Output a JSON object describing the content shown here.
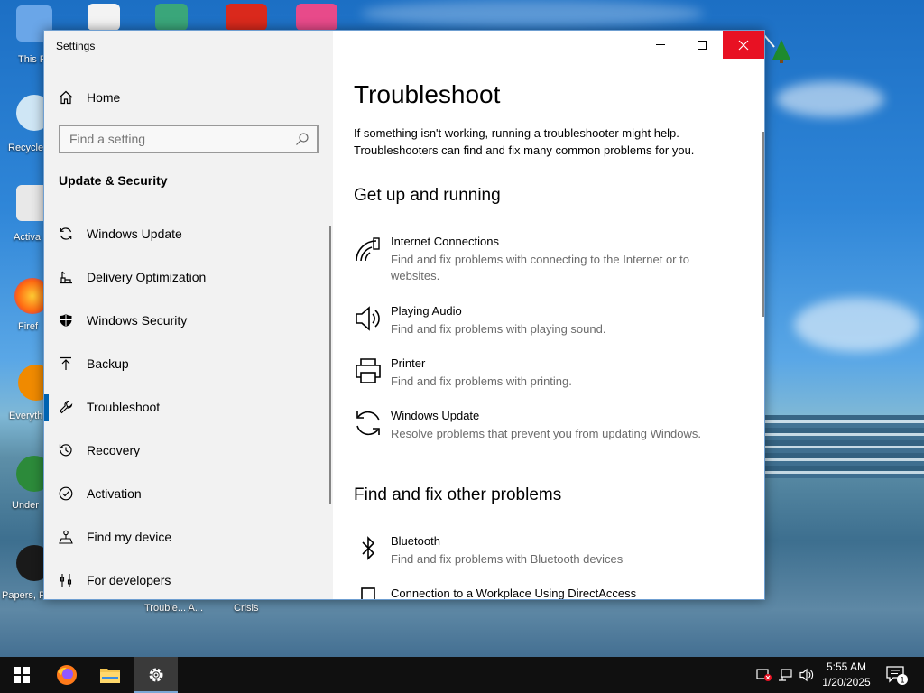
{
  "desktop": {
    "icons": [
      {
        "name": "this-pc",
        "label": "This P"
      },
      {
        "name": "recycle-bin",
        "label": "Recycle"
      },
      {
        "name": "activate",
        "label": "Activa"
      },
      {
        "name": "firefox",
        "label": "Firef"
      },
      {
        "name": "everything",
        "label": "Everyth"
      },
      {
        "name": "undertale",
        "label": "Under"
      },
      {
        "name": "papers",
        "label": "Papers, P"
      },
      {
        "name": "trouble",
        "label": "Trouble... A..."
      },
      {
        "name": "crisis",
        "label": "Crisis"
      }
    ]
  },
  "window": {
    "title": "Settings",
    "controls": {
      "minimize": "minimize",
      "maximize": "maximize",
      "close": "close"
    }
  },
  "sidebar": {
    "home_label": "Home",
    "search_placeholder": "Find a setting",
    "section_title": "Update & Security",
    "items": [
      {
        "label": "Windows Update",
        "icon": "sync-icon"
      },
      {
        "label": "Delivery Optimization",
        "icon": "delivery-icon"
      },
      {
        "label": "Windows Security",
        "icon": "shield-icon"
      },
      {
        "label": "Backup",
        "icon": "backup-arrow-icon"
      },
      {
        "label": "Troubleshoot",
        "icon": "wrench-icon",
        "selected": true
      },
      {
        "label": "Recovery",
        "icon": "recovery-icon"
      },
      {
        "label": "Activation",
        "icon": "check-circle-icon"
      },
      {
        "label": "Find my device",
        "icon": "person-pin-icon"
      },
      {
        "label": "For developers",
        "icon": "developer-icon"
      }
    ]
  },
  "main": {
    "title": "Troubleshoot",
    "intro": "If something isn't working, running a troubleshooter might help. Troubleshooters can find and fix many common problems for you.",
    "group1_title": "Get up and running",
    "group1": [
      {
        "name": "Internet Connections",
        "desc": "Find and fix problems with connecting to the Internet or to websites."
      },
      {
        "name": "Playing Audio",
        "desc": "Find and fix problems with playing sound."
      },
      {
        "name": "Printer",
        "desc": "Find and fix problems with printing."
      },
      {
        "name": "Windows Update",
        "desc": "Resolve problems that prevent you from updating Windows."
      }
    ],
    "group2_title": "Find and fix other problems",
    "group2": [
      {
        "name": "Bluetooth",
        "desc": "Find and fix problems with Bluetooth devices"
      },
      {
        "name": "Connection to a Workplace Using DirectAccess",
        "desc": ""
      }
    ]
  },
  "taskbar": {
    "time": "5:55 AM",
    "date": "1/20/2025",
    "notification_count": "1"
  }
}
